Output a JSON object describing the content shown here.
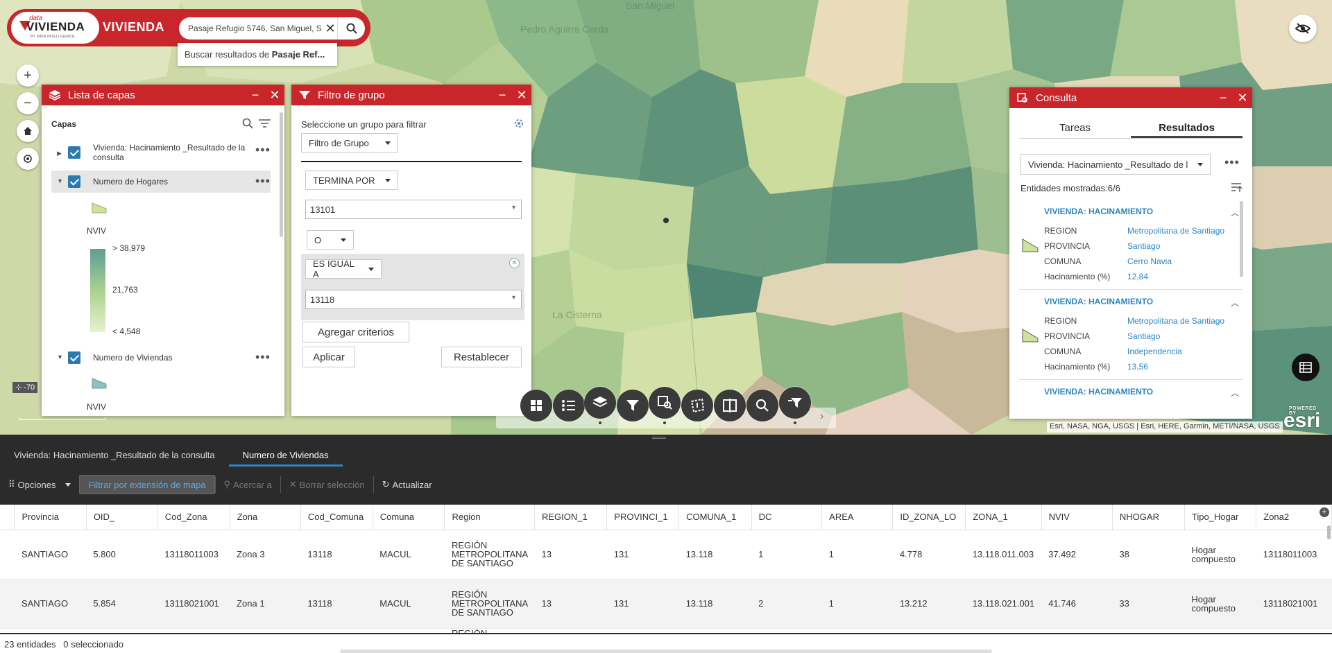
{
  "app": {
    "brand_small": "data",
    "brand_big": "VIVIENDA",
    "brand_sub": "BY DATA INTELLIGENCE",
    "title": "VIVIENDA"
  },
  "search": {
    "value": "Pasaje Refugio 5746, San Miguel, S",
    "suggestion_prefix": "Buscar resultados de ",
    "suggestion_bold": "Pasaje Ref..."
  },
  "map": {
    "labels": [
      "San Miguel",
      "Pedro Aguirre Cerda",
      "La Cisterna"
    ],
    "scale": "-70"
  },
  "layer_list": {
    "title": "Lista de capas",
    "section": "Capas",
    "layers": [
      {
        "name": "Vivienda: Hacinamiento _Resultado de la consulta"
      },
      {
        "name": "Numero de Hogares",
        "legend_field": "NVIV",
        "legend_max": "> 38,979",
        "legend_mid": "21,763",
        "legend_min": "< 4,548"
      },
      {
        "name": "Numero de Viviendas",
        "legend_field": "NVIV"
      }
    ]
  },
  "filter": {
    "title": "Filtro de grupo",
    "prompt": "Seleccione un grupo para filtrar",
    "group": "Filtro de Grupo",
    "op1": "TERMINA POR",
    "val1": "13101",
    "logic": "O",
    "op2": "ES IGUAL A",
    "val2": "13118",
    "add": "Agregar criterios",
    "apply": "Aplicar",
    "reset": "Restablecer"
  },
  "consulta": {
    "title": "Consulta",
    "tabs": [
      "Tareas",
      "Resultados"
    ],
    "layer": "Vivienda: Hacinamiento _Resultado de l",
    "count_label": "Entidades mostradas:6/6",
    "results": [
      {
        "heading": "VIVIENDA: HACINAMIENTO",
        "fields": [
          [
            "REGION",
            "Metropolitana de Santiago"
          ],
          [
            "PROVINCIA",
            "Santiago"
          ],
          [
            "COMUNA",
            "Cerro Navia"
          ],
          [
            "Hacinamiento (%)",
            "12,84"
          ]
        ]
      },
      {
        "heading": "VIVIENDA: HACINAMIENTO",
        "fields": [
          [
            "REGION",
            "Metropolitana de Santiago"
          ],
          [
            "PROVINCIA",
            "Santiago"
          ],
          [
            "COMUNA",
            "Independencia"
          ],
          [
            "Hacinamiento (%)",
            "13,56"
          ]
        ]
      },
      {
        "heading": "VIVIENDA: HACINAMIENTO",
        "fields": []
      }
    ]
  },
  "attribution": "Esri, NASA, NGA, USGS | Esri, HERE, Garmin, METI/NASA, USGS",
  "esri": {
    "powered": "POWERED BY",
    "name": "esri"
  },
  "table": {
    "tabs": [
      "Vivienda: Hacinamiento _Resultado de la consulta",
      "Numero de Viviendas"
    ],
    "toolbar": {
      "options": "Opciones",
      "filter": "Filtrar por extensión de mapa",
      "zoom": "Acercar a",
      "clear": "Borrar selección",
      "refresh": "Actualizar"
    },
    "columns": [
      "Provincia",
      "OID_",
      "Cod_Zona",
      "Zona",
      "Cod_Comuna",
      "Comuna",
      "Region",
      "REGION_1",
      "PROVINCI_1",
      "COMUNA_1",
      "DC",
      "AREA",
      "ID_ZONA_LO",
      "ZONA_1",
      "NVIV",
      "NHOGAR",
      "Tipo_Hogar",
      "Zona2"
    ],
    "rows": [
      [
        "SANTIAGO",
        "5.800",
        "13118011003",
        "Zona 3",
        "13118",
        "MACUL",
        "REGIÓN METROPOLITANA DE SANTIAGO",
        "13",
        "131",
        "13.118",
        "1",
        "1",
        "4.778",
        "13.118.011.003",
        "37.492",
        "38",
        "Hogar compuesto",
        "13118011003"
      ],
      [
        "SANTIAGO",
        "5.854",
        "13118021001",
        "Zona 1",
        "13118",
        "MACUL",
        "REGIÓN METROPOLITANA DE SANTIAGO",
        "13",
        "131",
        "13.118",
        "2",
        "1",
        "13.212",
        "13.118.021.001",
        "41.746",
        "33",
        "Hogar compuesto",
        "13118021001"
      ],
      [
        "",
        "",
        "",
        "",
        "",
        "",
        "REGIÓN",
        "",
        "",
        "",
        "",
        "",
        "",
        "",
        "",
        "",
        "",
        ""
      ]
    ],
    "status_count": "23 entidades",
    "status_selected": "0 seleccionado"
  }
}
